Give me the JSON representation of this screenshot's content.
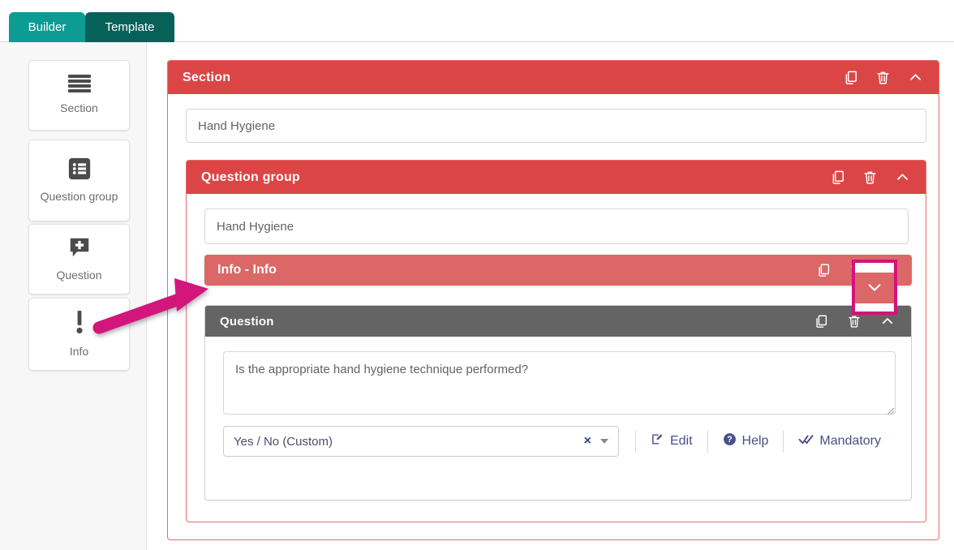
{
  "tabs": [
    {
      "id": "builder",
      "label": "Builder",
      "active": true
    },
    {
      "id": "template",
      "label": "Template",
      "active": false
    }
  ],
  "sidebar": {
    "items": [
      {
        "id": "section",
        "label": "Section",
        "icon": "hamburger-icon"
      },
      {
        "id": "qgroup",
        "label": "Question group",
        "icon": "list-box-icon"
      },
      {
        "id": "question",
        "label": "Question",
        "icon": "chat-plus-icon"
      },
      {
        "id": "info",
        "label": "Info",
        "icon": "exclamation-icon"
      }
    ]
  },
  "section": {
    "header_title": "Section",
    "actions": [
      {
        "id": "duplicate",
        "icon": "copy-icon"
      },
      {
        "id": "delete",
        "icon": "trash-icon"
      },
      {
        "id": "collapse",
        "icon": "chevron-up-icon"
      }
    ],
    "name_value": "Hand Hygiene",
    "name_placeholder": "Section name"
  },
  "question_group": {
    "header_title": "Question group",
    "actions": [
      {
        "id": "duplicate",
        "icon": "copy-icon"
      },
      {
        "id": "delete",
        "icon": "trash-icon"
      },
      {
        "id": "collapse",
        "icon": "chevron-up-icon"
      }
    ],
    "name_value": "Hand Hygiene",
    "name_placeholder": "Question group name"
  },
  "info_item": {
    "title": "Info - Info",
    "actions": [
      {
        "id": "duplicate",
        "icon": "copy-icon"
      },
      {
        "id": "delete",
        "icon": "trash-icon"
      },
      {
        "id": "expand",
        "icon": "chevron-down-icon"
      }
    ]
  },
  "question_item": {
    "header_title": "Question",
    "actions": [
      {
        "id": "duplicate",
        "icon": "copy-icon"
      },
      {
        "id": "delete",
        "icon": "trash-icon"
      },
      {
        "id": "collapse",
        "icon": "chevron-up-icon"
      }
    ],
    "text_value": "Is the appropriate hand hygiene technique performed?",
    "text_placeholder": "Question text",
    "answer_type": {
      "selected": "Yes / No (Custom)",
      "placeholder": "Select answer type",
      "clear_glyph": "×"
    },
    "buttons": [
      {
        "id": "edit",
        "label": "Edit",
        "icon": "pencil-square-icon"
      },
      {
        "id": "help",
        "label": "Help",
        "icon": "question-circle-icon"
      },
      {
        "id": "mandatory",
        "label": "Mandatory",
        "icon": "double-check-icon"
      }
    ]
  },
  "annotation": {
    "arrow_color": "#d3127c",
    "highlight_color": "#d3127c",
    "highlight_target": "info-expand-chevron"
  },
  "colors": {
    "tab_active": "#0c9c94",
    "tab_inactive": "#076159",
    "section_red": "#dc4545",
    "info_red": "#db6767",
    "question_gray": "#646464",
    "action_purple": "#4a4f8c",
    "annotation_pink": "#d3127c"
  }
}
